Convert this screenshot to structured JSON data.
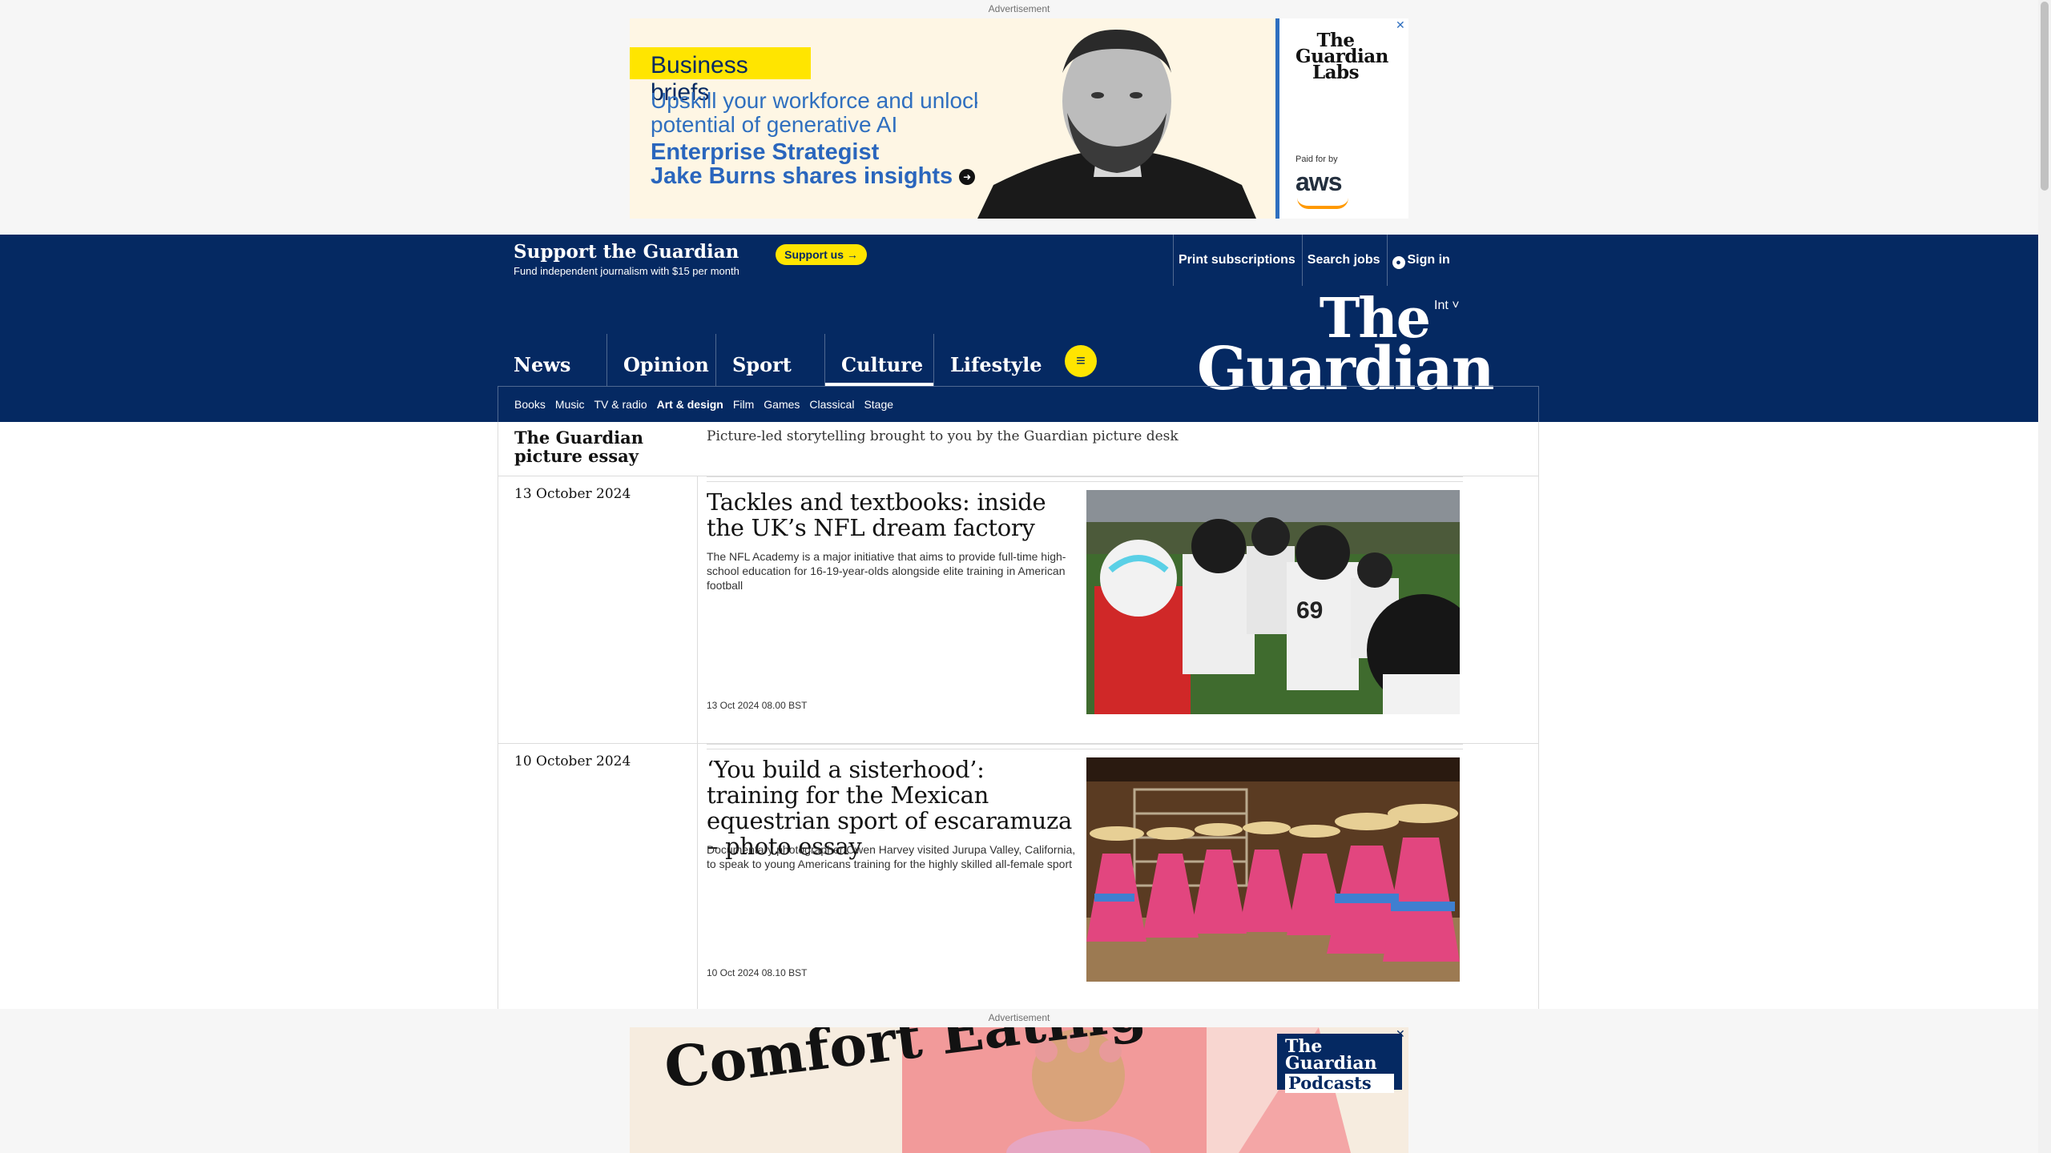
{
  "top_ad": {
    "label": "Advertisement",
    "tag": "Business briefs",
    "line1": "Upskill your workforce and unlock the",
    "line2": "potential of generative AI",
    "line3": "Enterprise Strategist",
    "line4": "Jake Burns shares insights",
    "labs_logo": "The Guardian Labs",
    "paid_by": "Paid for by",
    "sponsor": "aws",
    "close": "✕"
  },
  "support": {
    "title": "Support the Guardian",
    "subtitle": "Fund independent journalism with $15 per month",
    "button": "Support us →"
  },
  "top_links": {
    "print": "Print subscriptions",
    "jobs": "Search jobs",
    "signin": "Sign in"
  },
  "header": {
    "edition": "Int",
    "logo_the": "The",
    "logo_guardian": "Guardian",
    "menu_icon": "≡"
  },
  "pillars": [
    "News",
    "Opinion",
    "Sport",
    "Culture",
    "Lifestyle"
  ],
  "subnav": [
    "Books",
    "Music",
    "TV & radio",
    "Art & design",
    "Film",
    "Games",
    "Classical",
    "Stage"
  ],
  "series": {
    "title": "The Guardian picture essay",
    "description": "Picture-led storytelling brought to you by the Guardian picture desk"
  },
  "articles": [
    {
      "date": "13 October 2024",
      "headline": "Tackles and textbooks: inside the UK’s NFL dream factory",
      "standfirst": "The NFL Academy is a major initiative that aims to provide full-time high-school education for 16-19-year-olds alongside elite training in American football",
      "time": "13 Oct 2024 08.00 BST"
    },
    {
      "date": "10 October 2024",
      "headline": "‘You build a sisterhood’: training for the Mexican equestrian sport of escaramuza – photo essay",
      "standfirst": "Documentary photographer Owen Harvey visited Jurupa Valley, California, to speak to young Americans training for the highly skilled all-female sport",
      "time": "10 Oct 2024 08.10 BST"
    }
  ],
  "bottom_ad": {
    "label": "Advertisement",
    "headline": "Comfort Eating",
    "logo_guardian": "The Guardian",
    "logo_podcasts": "Podcasts",
    "close": "✕"
  },
  "colors": {
    "brand_blue": "#052962",
    "yellow": "#ffe500",
    "ad_blue": "#2f6fbf"
  }
}
